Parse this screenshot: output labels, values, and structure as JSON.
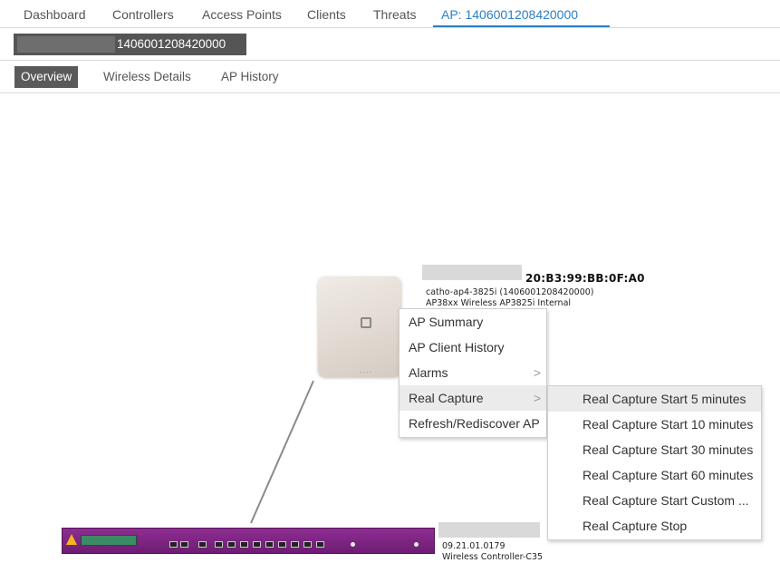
{
  "topnav": {
    "tabs": [
      {
        "label": "Dashboard"
      },
      {
        "label": "Controllers"
      },
      {
        "label": "Access Points"
      },
      {
        "label": "Clients"
      },
      {
        "label": "Threats"
      },
      {
        "label": "AP: 1406001208420000"
      }
    ],
    "active_tab": "AP: 1406001208420000"
  },
  "header": {
    "title": "1406001208420000"
  },
  "subtabs": [
    {
      "label": "Overview"
    },
    {
      "label": "Wireless Details"
    },
    {
      "label": "AP History"
    }
  ],
  "ap_node": {
    "mac": "20:B3:99:BB:0F:A0",
    "name_line": "catho-ap4-3825i (1406001208420000)",
    "model_line": "AP38xx Wireless AP3825i Internal"
  },
  "context_menu": {
    "items": [
      {
        "label": "AP Summary"
      },
      {
        "label": "AP Client History"
      },
      {
        "label": "Alarms",
        "submenu_icon": "chevron-right-icon"
      },
      {
        "label": "Real Capture",
        "submenu_icon": "chevron-right-icon"
      },
      {
        "label": "Refresh/Rediscover AP"
      }
    ],
    "chevron": ">"
  },
  "submenu": {
    "items": [
      {
        "label": "Real Capture Start 5 minutes"
      },
      {
        "label": "Real Capture Start 10 minutes"
      },
      {
        "label": "Real Capture Start 30 minutes"
      },
      {
        "label": "Real Capture Start 60 minutes"
      },
      {
        "label": "Real Capture Start Custom ..."
      },
      {
        "label": "Real Capture Stop"
      }
    ]
  },
  "controller_node": {
    "version": "09.21.01.0179",
    "name": "Wireless Controller-C35"
  },
  "colors": {
    "accent": "#2a7fc8",
    "controller_purple": "#7b2280",
    "tab_dark": "#555555"
  }
}
